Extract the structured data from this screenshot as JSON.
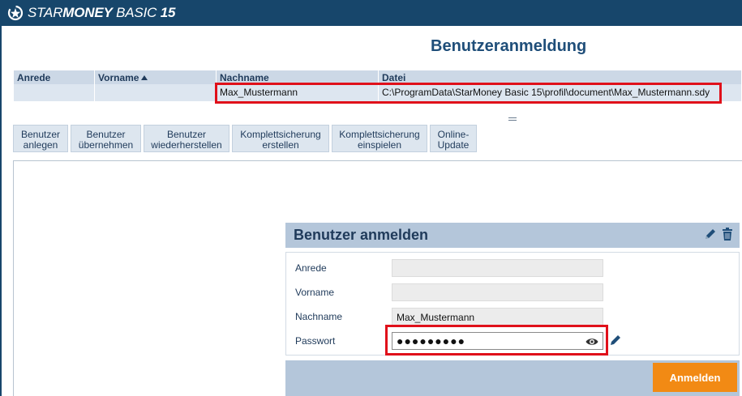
{
  "app": {
    "brand_prefix": "STAR",
    "brand_main": "MONEY",
    "brand_suffix": " BASIC ",
    "brand_version": "15"
  },
  "page": {
    "title": "Benutzeranmeldung"
  },
  "table": {
    "columns": [
      "Anrede",
      "Vorname",
      "Nachname",
      "Datei"
    ],
    "sorted_column": "Vorname",
    "rows": [
      {
        "anrede": "",
        "vorname": "",
        "nachname": "Max_Mustermann",
        "datei": "C:\\ProgramData\\StarMoney Basic 15\\profil\\document\\Max_Mustermann.sdy"
      }
    ]
  },
  "toolbar": {
    "buttons": [
      "Benutzer\nanlegen",
      "Benutzer\nübernehmen",
      "Benutzer\nwiederherstellen",
      "Komplettsicherung\nerstellen",
      "Komplettsicherung\neinspielen",
      "Online-\nUpdate"
    ]
  },
  "login_panel": {
    "title": "Benutzer anmelden",
    "fields": {
      "anrede": {
        "label": "Anrede",
        "value": ""
      },
      "vorname": {
        "label": "Vorname",
        "value": ""
      },
      "nachname": {
        "label": "Nachname",
        "value": "Max_Mustermann"
      },
      "passwort": {
        "label": "Passwort",
        "value": "●●●●●●●●●"
      }
    },
    "submit_label": "Anmelden"
  },
  "colors": {
    "titlebar": "#17466b",
    "highlight": "#e0101a",
    "accent_button": "#f28a14",
    "panel": "#b4c6da"
  },
  "icons": [
    "starmoney-logo-icon",
    "sort-ascending-icon",
    "pencil-icon",
    "trash-icon",
    "eye-icon",
    "pencil-icon"
  ]
}
